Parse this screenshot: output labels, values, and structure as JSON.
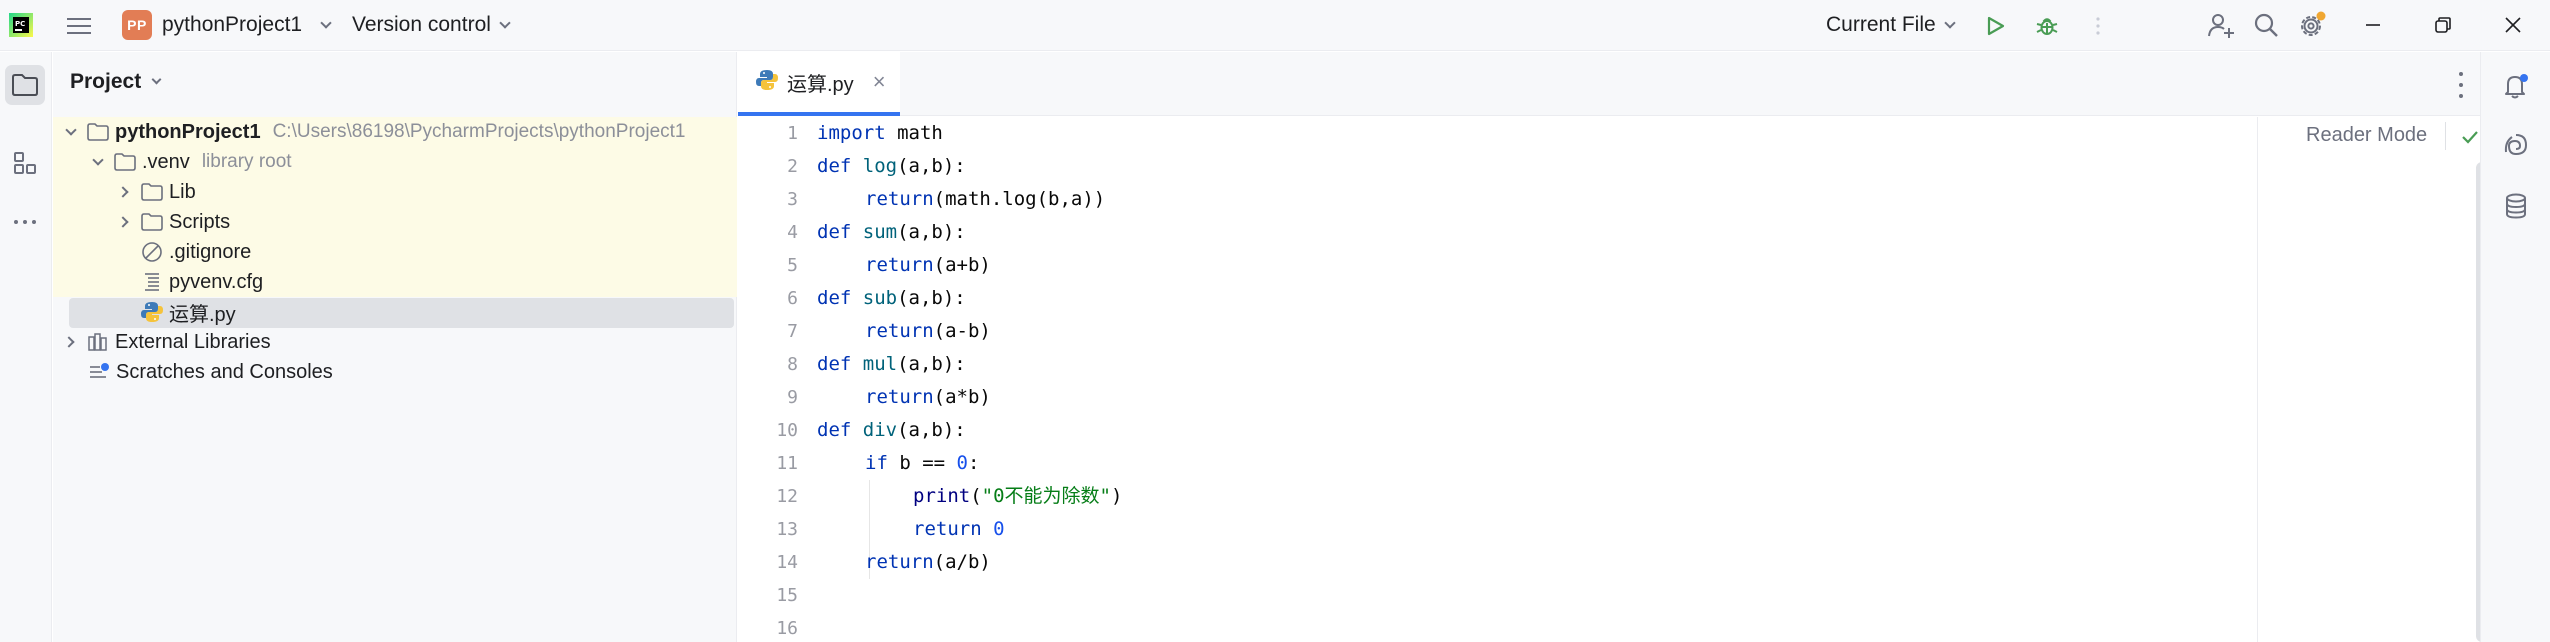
{
  "titlebar": {
    "project_badge": "PP",
    "project_name": "pythonProject1",
    "vcs_label": "Version control",
    "run_config": "Current File"
  },
  "project_panel": {
    "title": "Project",
    "tree": [
      {
        "label": "pythonProject1",
        "hint": "C:\\Users\\86198\\PycharmProjects\\pythonProject1"
      },
      {
        "label": ".venv",
        "hint": "library root"
      },
      {
        "label": "Lib"
      },
      {
        "label": "Scripts"
      },
      {
        "label": ".gitignore"
      },
      {
        "label": "pyvenv.cfg"
      },
      {
        "label": "运算.py"
      },
      {
        "label": "External Libraries"
      },
      {
        "label": "Scratches and Consoles"
      }
    ]
  },
  "editor": {
    "tab_label": "运算.py",
    "reader_mode": "Reader Mode",
    "line_numbers": [
      "1",
      "2",
      "3",
      "4",
      "5",
      "6",
      "7",
      "8",
      "9",
      "10",
      "11",
      "12",
      "13",
      "14",
      "15",
      "16"
    ],
    "code": {
      "l1_kw": "import",
      "l1_rest": " math",
      "l2_kw": "def",
      "l2_fn": "log",
      "l2_rest": "(a,b):",
      "l3_kw": "return",
      "l3_rest": "(math.log(b,a))",
      "l4_kw": "def",
      "l4_fn": "sum",
      "l4_rest": "(a,b):",
      "l5_kw": "return",
      "l5_rest": "(a+b)",
      "l6_kw": "def",
      "l6_fn": "sub",
      "l6_rest": "(a,b):",
      "l7_kw": "return",
      "l7_rest": "(a-b)",
      "l8_kw": "def",
      "l8_fn": "mul",
      "l8_rest": "(a,b):",
      "l9_kw": "return",
      "l9_rest": "(a*b)",
      "l10_kw": "def",
      "l10_fn": "div",
      "l10_rest": "(a,b):",
      "l11_kw": "if",
      "l11_mid": " b == ",
      "l11_num": "0",
      "l11_end": ":",
      "l12_fn": "print",
      "l12_open": "(",
      "l12_str": "\"0不能为除数\"",
      "l12_close": ")",
      "l13_kw": "return",
      "l13_num": " 0",
      "l14_kw": "return",
      "l14_rest": "(a/b)"
    }
  },
  "colors": {
    "accent": "#3574f0",
    "keyword": "#0033b3",
    "function": "#00627a",
    "string": "#067d17",
    "number": "#1750eb",
    "run_green": "#499c54"
  }
}
